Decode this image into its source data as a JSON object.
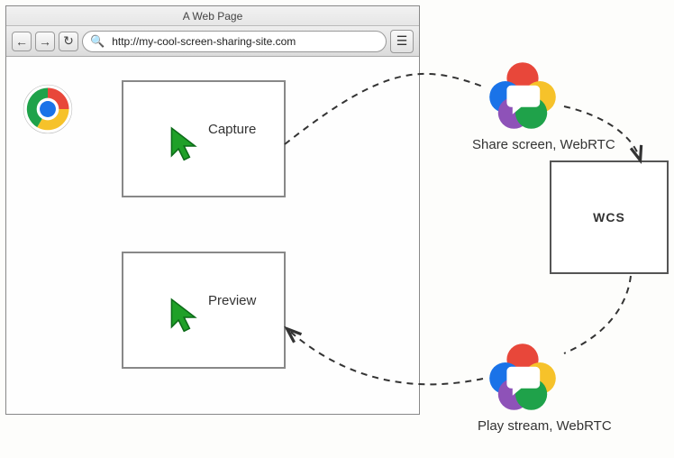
{
  "browser": {
    "title": "A Web Page",
    "url": "http://my-cool-screen-sharing-site.com"
  },
  "frames": {
    "capture_label": "Capture",
    "preview_label": "Preview"
  },
  "server": {
    "label": "WCS"
  },
  "captions": {
    "share": "Share screen, WebRTC",
    "play": "Play stream, WebRTC"
  }
}
